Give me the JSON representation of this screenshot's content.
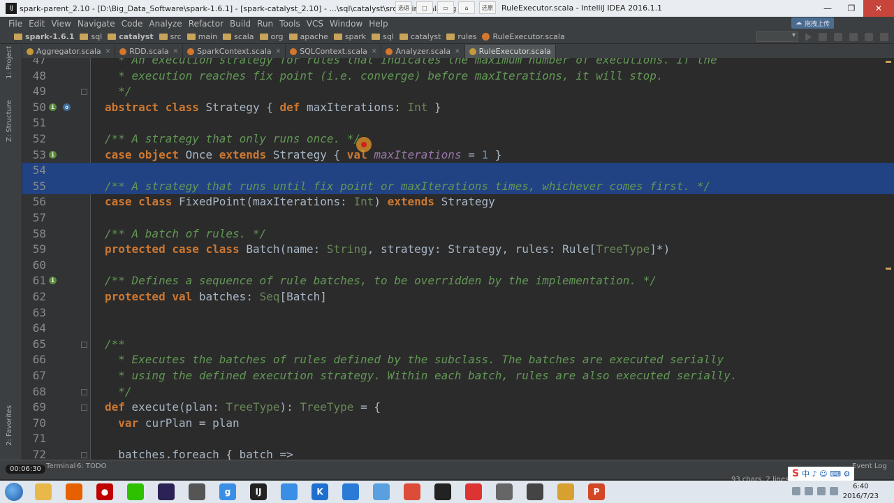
{
  "window": {
    "title": "spark-parent_2.10 - [D:\\Big_Data_Software\\spark-1.6.1] - [spark-catalyst_2.10] - ...\\sql\\catalyst\\src\\main\\scala\\org",
    "title_right": "RuleExecutor.scala - IntelliJ IDEA 2016.1.1",
    "mini_buttons": [
      "选语",
      "",
      "",
      "",
      "还原"
    ]
  },
  "menu": [
    "File",
    "Edit",
    "View",
    "Navigate",
    "Code",
    "Analyze",
    "Refactor",
    "Build",
    "Run",
    "Tools",
    "VCS",
    "Window",
    "Help"
  ],
  "upload_badge": "拖拽上传",
  "breadcrumbs": [
    {
      "label": "spark-1.6.1",
      "bold": true
    },
    {
      "label": "sql"
    },
    {
      "label": "catalyst",
      "bold": true
    },
    {
      "label": "src"
    },
    {
      "label": "main"
    },
    {
      "label": "scala"
    },
    {
      "label": "org"
    },
    {
      "label": "apache"
    },
    {
      "label": "spark"
    },
    {
      "label": "sql"
    },
    {
      "label": "catalyst"
    },
    {
      "label": "rules"
    },
    {
      "label": "RuleExecutor.scala",
      "file": true
    }
  ],
  "tabs": [
    {
      "label": "Aggregator.scala"
    },
    {
      "label": "RDD.scala"
    },
    {
      "label": "SparkContext.scala"
    },
    {
      "label": "SQLContext.scala"
    },
    {
      "label": "Analyzer.scala"
    },
    {
      "label": "RuleExecutor.scala",
      "active": true
    }
  ],
  "side_labels": {
    "project": "1: Project",
    "structure": "Z: Structure",
    "favorites": "2: Favorites"
  },
  "code_lines": [
    {
      "n": "47",
      "t": "  * An execution strategy for rules that indicates the maximum number of executions. If the"
    },
    {
      "n": "48",
      "t": "  * execution reaches fix point (i.e. converge) before maxIterations, it will stop."
    },
    {
      "n": "49",
      "t": "  */"
    },
    {
      "n": "50",
      "t": "abstract class Strategy { def maxIterations: Int }"
    },
    {
      "n": "51",
      "t": ""
    },
    {
      "n": "52",
      "t": "/** A strategy that only runs once. */"
    },
    {
      "n": "53",
      "t": "case object Once extends Strategy { val maxIterations = 1 }"
    },
    {
      "n": "54",
      "t": ""
    },
    {
      "n": "55",
      "t": "/** A strategy that runs until fix point or maxIterations times, whichever comes first. */"
    },
    {
      "n": "56",
      "t": "case class FixedPoint(maxIterations: Int) extends Strategy"
    },
    {
      "n": "57",
      "t": ""
    },
    {
      "n": "58",
      "t": "/** A batch of rules. */"
    },
    {
      "n": "59",
      "t": "protected case class Batch(name: String, strategy: Strategy, rules: Rule[TreeType]*)"
    },
    {
      "n": "60",
      "t": ""
    },
    {
      "n": "61",
      "t": "/** Defines a sequence of rule batches, to be overridden by the implementation. */"
    },
    {
      "n": "62",
      "t": "protected val batches: Seq[Batch]"
    },
    {
      "n": "63",
      "t": ""
    },
    {
      "n": "64",
      "t": ""
    },
    {
      "n": "65",
      "t": "/**"
    },
    {
      "n": "66",
      "t": "  * Executes the batches of rules defined by the subclass. The batches are executed serially"
    },
    {
      "n": "67",
      "t": "  * using the defined execution strategy. Within each batch, rules are also executed serially."
    },
    {
      "n": "68",
      "t": "  */"
    },
    {
      "n": "69",
      "t": "def execute(plan: TreeType): TreeType = {"
    },
    {
      "n": "70",
      "t": "  var curPlan = plan"
    },
    {
      "n": "71",
      "t": ""
    },
    {
      "n": "72",
      "t": "  batches.foreach { batch =>"
    }
  ],
  "status": {
    "timer": "00:06:30",
    "terminal": "Terminal",
    "todo": "6: TODO",
    "chars": "93 chars, 2 lines",
    "event_log": "Event Log"
  },
  "ime": {
    "brand": "S",
    "label": "中 ♪ ☺ ⌨ ⚙"
  },
  "clock": {
    "time": "6:40",
    "date": "2016/7/23"
  },
  "taskbar_apps": [
    {
      "name": "explorer",
      "color": "#e8b84a",
      "glyph": ""
    },
    {
      "name": "firefox",
      "color": "#e66000",
      "glyph": ""
    },
    {
      "name": "record",
      "color": "#c00000",
      "glyph": "●"
    },
    {
      "name": "wechat",
      "color": "#2dc100",
      "glyph": ""
    },
    {
      "name": "eclipse",
      "color": "#2c2255",
      "glyph": ""
    },
    {
      "name": "terminal",
      "color": "#555",
      "glyph": ""
    },
    {
      "name": "qq-browser",
      "color": "#3a8ee6",
      "glyph": "g"
    },
    {
      "name": "intellij",
      "color": "#222",
      "glyph": "IJ"
    },
    {
      "name": "pen",
      "color": "#3a8ee6",
      "glyph": ""
    },
    {
      "name": "k-app",
      "color": "#1e6fd0",
      "glyph": "K"
    },
    {
      "name": "share",
      "color": "#2b7bd6",
      "glyph": ""
    },
    {
      "name": "globe",
      "color": "#5aa0e0",
      "glyph": ""
    },
    {
      "name": "chrome",
      "color": "#dd4b39",
      "glyph": ""
    },
    {
      "name": "qq",
      "color": "#222",
      "glyph": ""
    },
    {
      "name": "mail",
      "color": "#d33",
      "glyph": ""
    },
    {
      "name": "gear",
      "color": "#666",
      "glyph": ""
    },
    {
      "name": "vm",
      "color": "#444",
      "glyph": ""
    },
    {
      "name": "cat",
      "color": "#d8a030",
      "glyph": ""
    },
    {
      "name": "ppt",
      "color": "#d24726",
      "glyph": "P"
    }
  ]
}
